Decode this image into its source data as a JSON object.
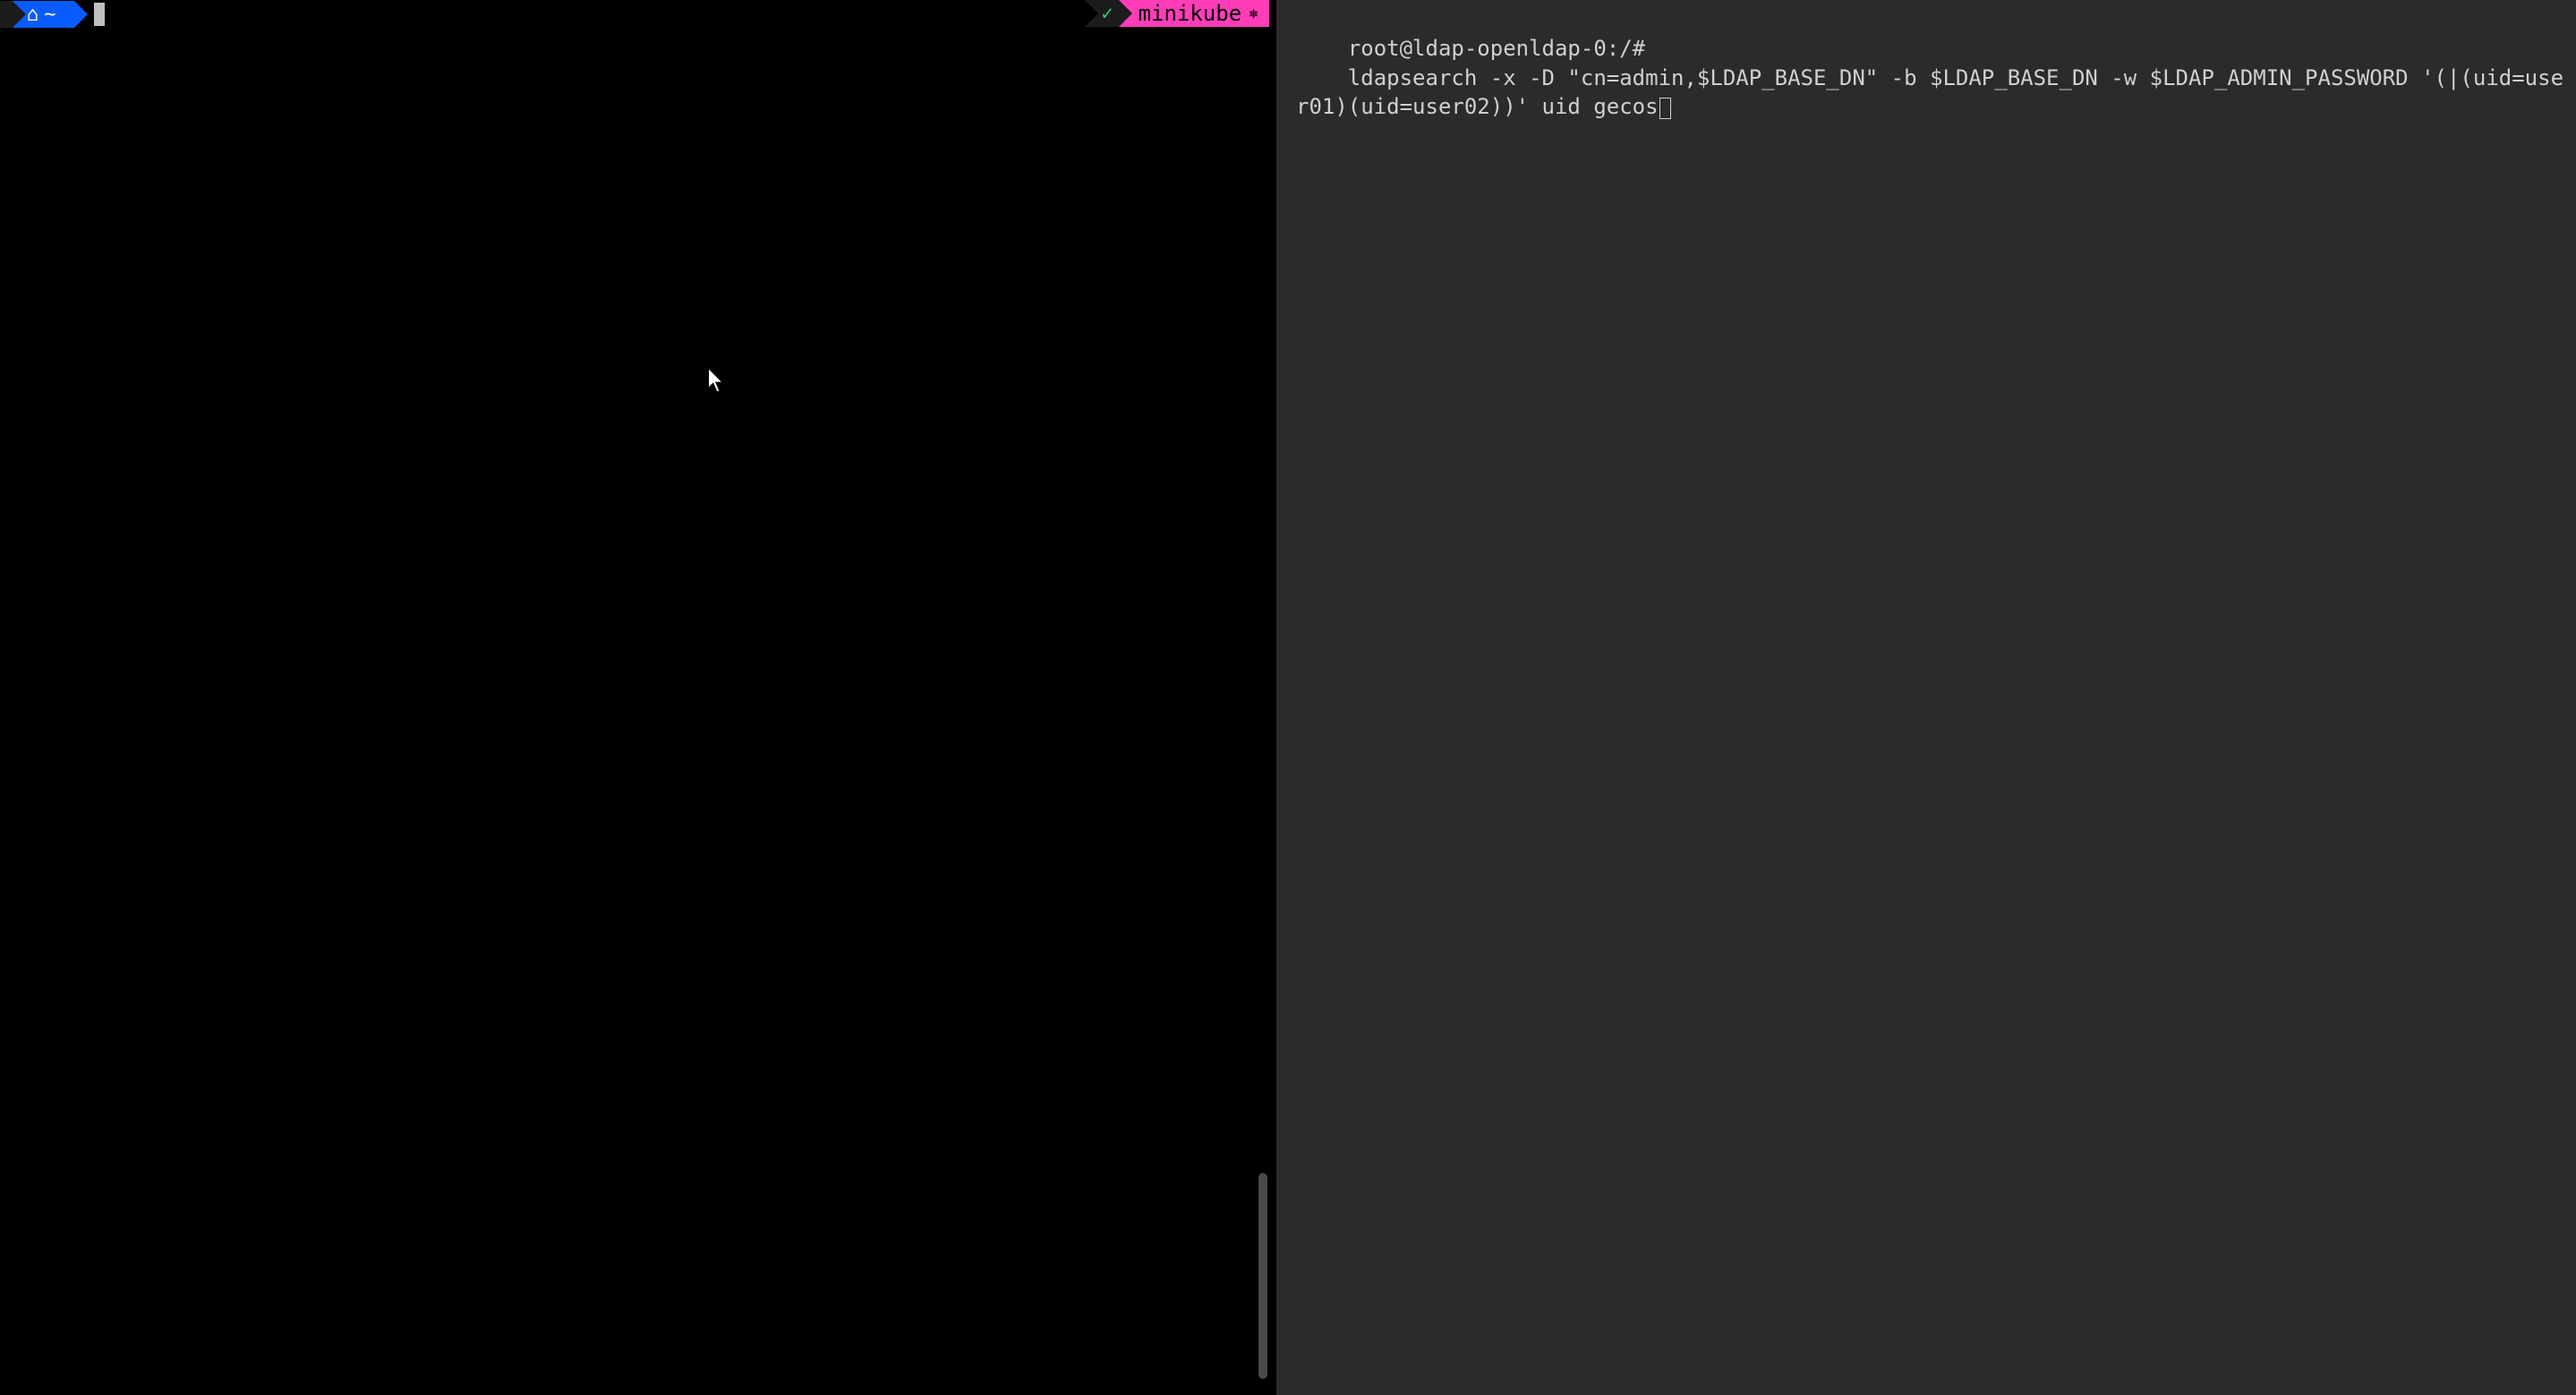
{
  "left_pane": {
    "prompt": {
      "apple_icon": "",
      "home_icon": "⌂",
      "tilde": "~"
    },
    "status": {
      "check": "✓",
      "context_label": "minikube",
      "context_icon": "⎈"
    }
  },
  "right_pane": {
    "prompt_prefix": "root@ldap-openldap-0:/#",
    "command": "ldapsearch -x -D \"cn=admin,$LDAP_BASE_DN\" -b $LDAP_BASE_DN -w $LDAP_ADMIN_PASSWORD '(|(uid=user01)(uid=user02))' uid gecos"
  }
}
